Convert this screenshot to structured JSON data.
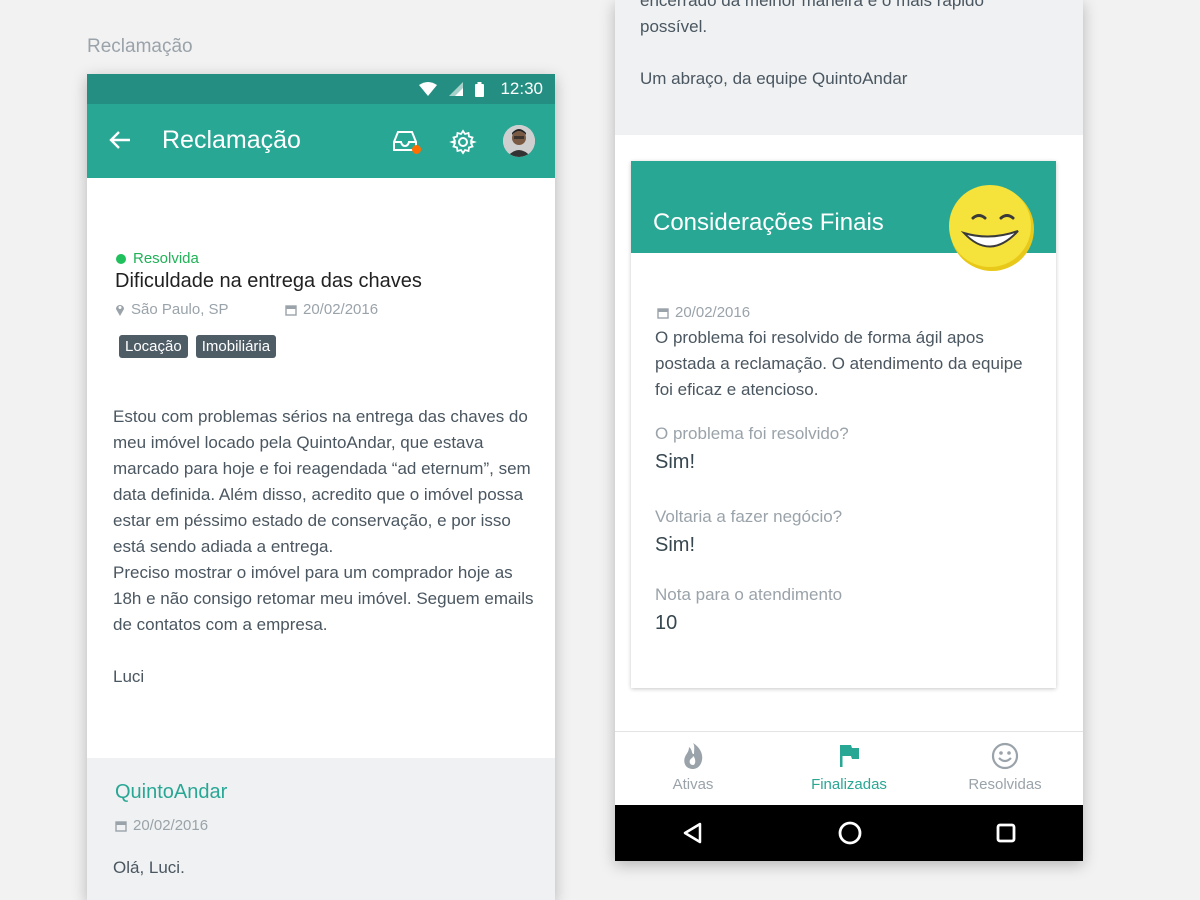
{
  "page": {
    "label": "Reclamação"
  },
  "status_bar": {
    "time": "12:30"
  },
  "appbar": {
    "title": "Reclamação"
  },
  "complaint": {
    "status": "Resolvida",
    "title": "Dificuldade na entrega das chaves",
    "location": "São Paulo, SP",
    "date": "20/02/2016",
    "tags": [
      "Locação",
      "Imobiliária"
    ],
    "body": "Estou com problemas sérios na entrega das chaves do meu imóvel locado pela QuintoAndar, que estava marcado para hoje e foi reagendada “ad eternum”, sem data definida. Além disso, acredito que o imóvel possa estar em péssimo estado de conservação, e por isso está sendo adiada a entrega.\nPreciso mostrar o imóvel para um comprador hoje as 18h e não consigo retomar meu imóvel. Seguem emails de contatos com a empresa.\n\nLuci"
  },
  "reply": {
    "author": "QuintoAndar",
    "date": "20/02/2016",
    "text": "Olá, Luci."
  },
  "reply_end": {
    "text": "encerrado da melhor maneira e o mais rápido\npossível.\n\nUm abraço, da equipe QuintoAndar"
  },
  "final_card": {
    "title": "Considerações Finais",
    "date": "20/02/2016",
    "comment": "O problema foi resolvido de forma ágil apos postada a reclamação. O atendimento da equipe foi eficaz e atencioso.",
    "q1": "O problema foi resolvido?",
    "a1": "Sim!",
    "q2": "Voltaria a fazer negócio?",
    "a2": "Sim!",
    "q3": "Nota para o atendimento",
    "a3": "10"
  },
  "bottom_nav": {
    "items": [
      {
        "label": "Ativas",
        "icon": "flame-icon"
      },
      {
        "label": "Finalizadas",
        "icon": "flag-icon",
        "active": true
      },
      {
        "label": "Resolvidas",
        "icon": "smiley-icon"
      }
    ]
  },
  "colors": {
    "primary": "#29a795",
    "status_bar": "#238e81",
    "resolved": "#20c05c",
    "badge_dot": "#ff6d00"
  }
}
